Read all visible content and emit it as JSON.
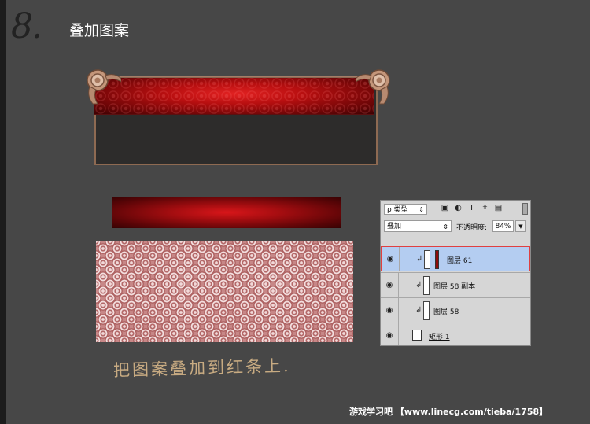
{
  "step_number": "8.",
  "title": "叠加图案",
  "layers_panel": {
    "filter_label": "ρ 类型",
    "filter_icons": [
      "image-filter-icon",
      "adjustment-filter-icon",
      "text-filter-icon",
      "shape-filter-icon",
      "smart-object-filter-icon"
    ],
    "blend_mode": "叠加",
    "opacity_label": "不透明度:",
    "opacity_value": "84%",
    "layers": [
      {
        "name": "图层 61",
        "selected": true
      },
      {
        "name": "图层 58 副本",
        "selected": false
      },
      {
        "name": "图层 58",
        "selected": false
      },
      {
        "name": "矩形 1",
        "selected": false
      }
    ]
  },
  "caption": "把图案叠加到红条上.",
  "watermark": "游戏学习吧 【www.linecg.com/tieba/1758】",
  "colors": {
    "background": "#474747",
    "red_band": "#c41214",
    "frame_gold": "#b88a6c",
    "pattern_pink": "#c78787",
    "selection_blue": "#b4cdf1",
    "caption_gold": "#c8ab82"
  }
}
